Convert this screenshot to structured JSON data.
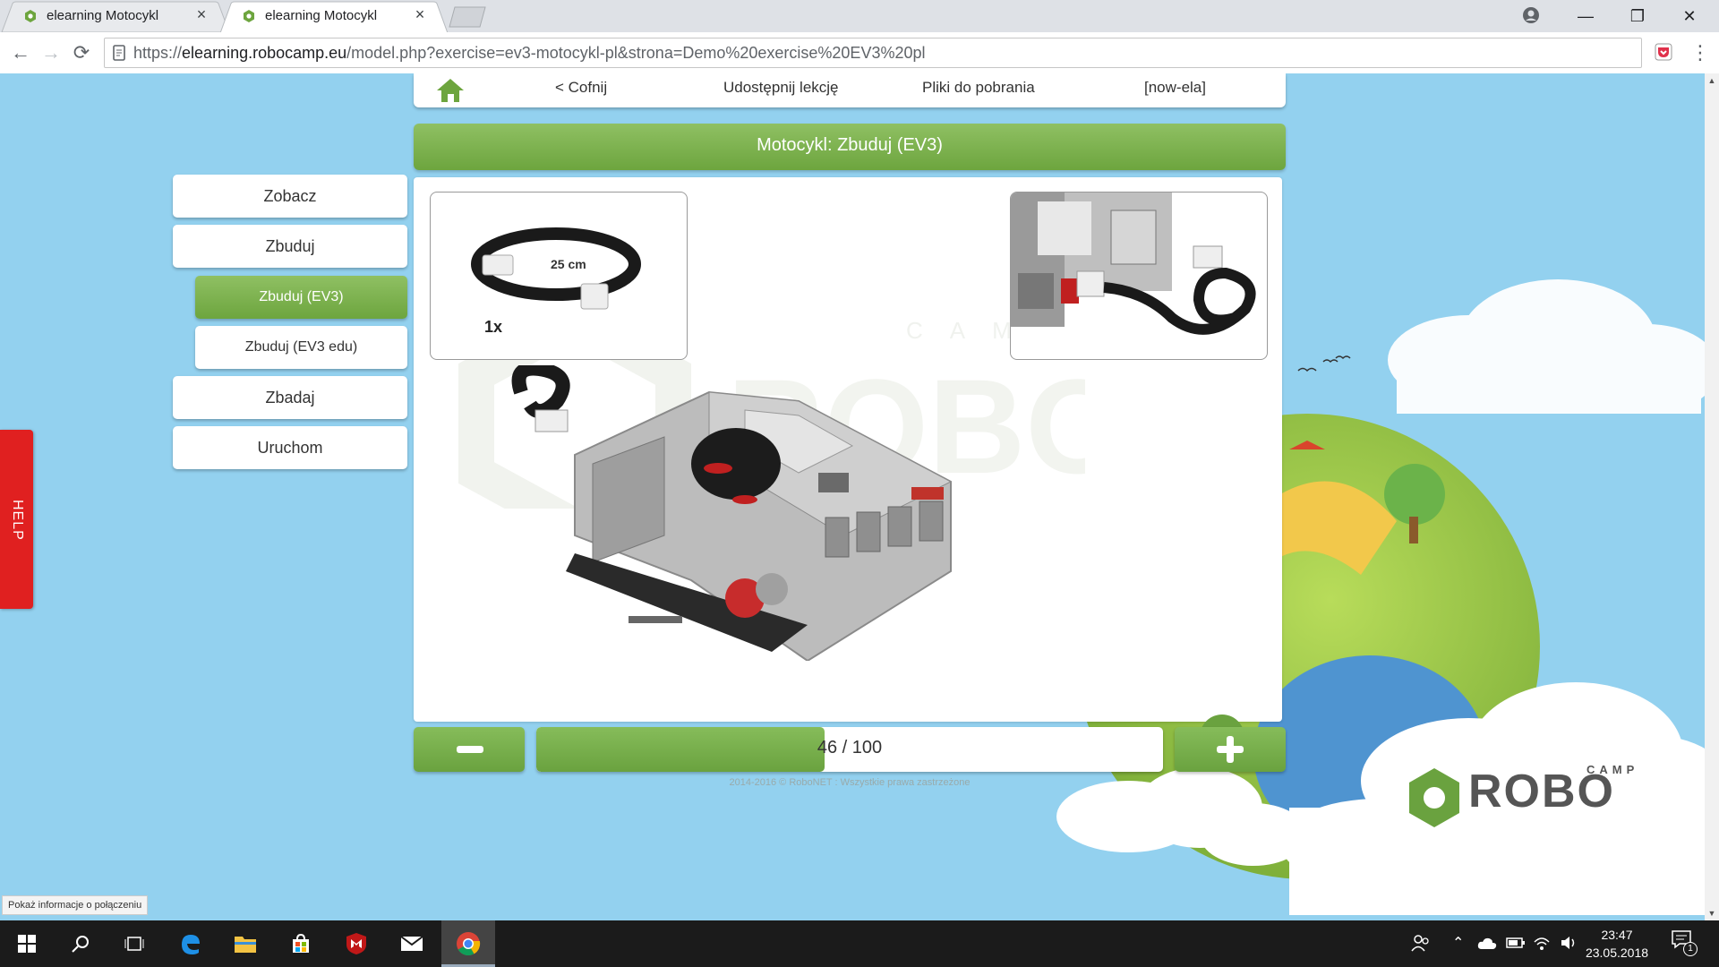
{
  "browser": {
    "tabs": [
      {
        "title": "elearning Motocykl",
        "close": "×"
      },
      {
        "title": "elearning Motocykl",
        "close": "×"
      }
    ],
    "window_controls": {
      "minimize": "—",
      "restore": "❐",
      "close": "✕"
    },
    "nav": {
      "back": "←",
      "forward": "→",
      "reload": "⟳"
    },
    "url": {
      "scheme": "https://",
      "host": "elearning.robocamp.eu",
      "path": "/model.php?exercise=ev3-motocykl-pl&strona=Demo%20exercise%20EV3%20pl"
    },
    "menu": "⋮"
  },
  "site": {
    "topnav": {
      "back": "< Cofnij",
      "share": "Udostępnij lekcję",
      "downloads": "Pliki do pobrania",
      "user": "[now-ela]"
    },
    "title": "Motocykl: Zbuduj (EV3)",
    "sidebar": [
      {
        "label": "Zobacz",
        "active": false,
        "sub": false
      },
      {
        "label": "Zbuduj",
        "active": false,
        "sub": false
      },
      {
        "label": "Zbuduj (EV3)",
        "active": true,
        "sub": true
      },
      {
        "label": "Zbuduj (EV3 edu)",
        "active": false,
        "sub": true
      },
      {
        "label": "Zbadaj",
        "active": false,
        "sub": false
      },
      {
        "label": "Uruchom",
        "active": false,
        "sub": false
      }
    ],
    "help_label": "HELP",
    "instruction": {
      "part_length": "25 cm",
      "part_quantity": "1x"
    },
    "progress": {
      "text": "46 / 100",
      "current": 46,
      "total": 100
    },
    "copyright": "2014-2016 © RoboNET : Wszystkie prawa zastrzeżone",
    "logo": {
      "camp": "CAMP",
      "robo": "ROBO"
    }
  },
  "statusbar": "Pokaż informacje o połączeniu",
  "taskbar": {
    "time": "23:47",
    "date": "23.05.2018",
    "notification_count": "1"
  },
  "colors": {
    "green": "#6da53e",
    "sky": "#93d1ef",
    "help_red": "#e02020"
  }
}
